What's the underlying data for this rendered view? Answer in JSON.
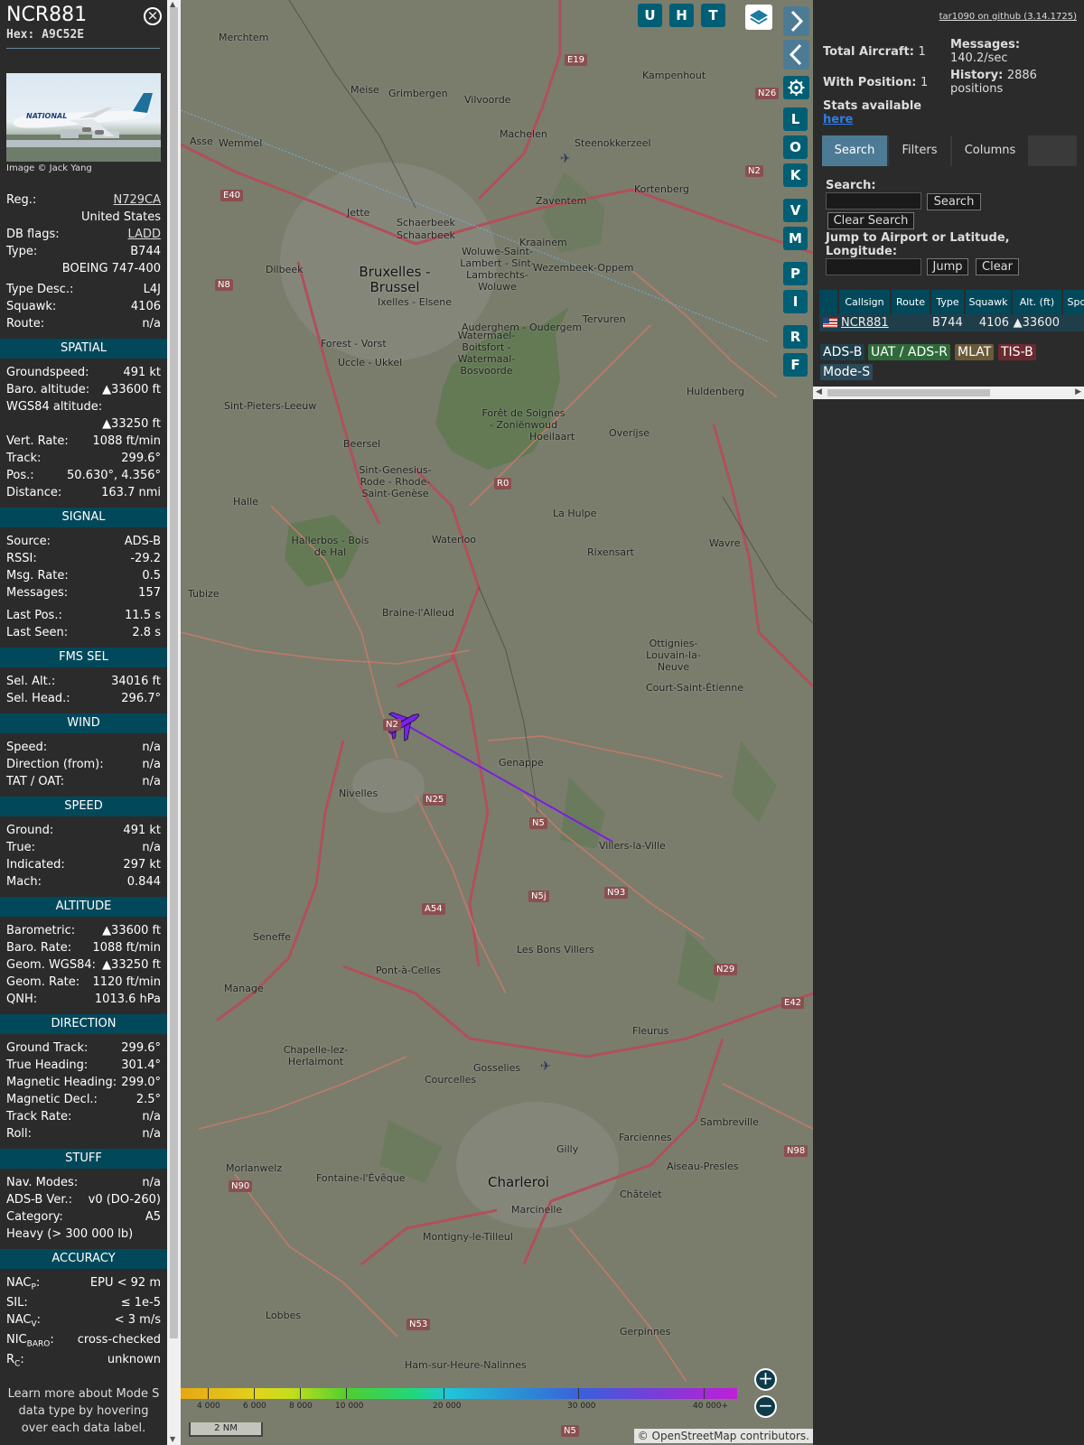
{
  "sidebar": {
    "callsign": "NCR881",
    "hex_label": "Hex: A9C52E",
    "photo_credit": "Image © Jack Yang",
    "photo_livery_text": "NATIONAL",
    "reg": {
      "label": "Reg.:",
      "value": "N729CA"
    },
    "country": "United States",
    "db_flags": {
      "label": "DB flags:",
      "value": "LADD"
    },
    "type": {
      "label": "Type:",
      "value": "B744"
    },
    "type_name": "BOEING 747-400",
    "type_desc": {
      "label": "Type Desc.:",
      "value": "L4J"
    },
    "squawk": {
      "label": "Squawk:",
      "value": "4106"
    },
    "route": {
      "label": "Route:",
      "value": "n/a"
    },
    "sections": {
      "spatial": "SPATIAL",
      "signal": "SIGNAL",
      "fms": "FMS SEL",
      "wind": "WIND",
      "speed": "SPEED",
      "altitude": "ALTITUDE",
      "direction": "DIRECTION",
      "stuff": "STUFF",
      "accuracy": "ACCURACY"
    },
    "spatial": {
      "groundspeed": {
        "label": "Groundspeed:",
        "value": "491 kt"
      },
      "baro_alt": {
        "label": "Baro. altitude:",
        "value": "▲33600 ft"
      },
      "wgs84_label": "WGS84 altitude:",
      "wgs84_value": "▲33250 ft",
      "vert_rate": {
        "label": "Vert. Rate:",
        "value": "1088 ft/min"
      },
      "track": {
        "label": "Track:",
        "value": "299.6°"
      },
      "pos": {
        "label": "Pos.:",
        "value": "50.630°, 4.356°"
      },
      "distance": {
        "label": "Distance:",
        "value": "163.7 nmi"
      }
    },
    "signal": {
      "source": {
        "label": "Source:",
        "value": "ADS-B"
      },
      "rssi": {
        "label": "RSSI:",
        "value": "-29.2"
      },
      "msg_rate": {
        "label": "Msg. Rate:",
        "value": "0.5"
      },
      "messages": {
        "label": "Messages:",
        "value": "157"
      },
      "last_pos": {
        "label": "Last Pos.:",
        "value": "11.5 s"
      },
      "last_seen": {
        "label": "Last Seen:",
        "value": "2.8 s"
      }
    },
    "fms": {
      "sel_alt": {
        "label": "Sel. Alt.:",
        "value": "34016 ft"
      },
      "sel_head": {
        "label": "Sel. Head.:",
        "value": "296.7°"
      }
    },
    "wind": {
      "speed": {
        "label": "Speed:",
        "value": "n/a"
      },
      "direction": {
        "label": "Direction (from):",
        "value": "n/a"
      },
      "tat_oat": {
        "label": "TAT / OAT:",
        "value": "n/a"
      }
    },
    "speed": {
      "ground": {
        "label": "Ground:",
        "value": "491 kt"
      },
      "true": {
        "label": "True:",
        "value": "n/a"
      },
      "indicated": {
        "label": "Indicated:",
        "value": "297 kt"
      },
      "mach": {
        "label": "Mach:",
        "value": "0.844"
      }
    },
    "altitude": {
      "barometric": {
        "label": "Barometric:",
        "value": "▲33600 ft"
      },
      "baro_rate": {
        "label": "Baro. Rate:",
        "value": "1088 ft/min"
      },
      "geom_wgs84": {
        "label": "Geom. WGS84:",
        "value": "▲33250 ft"
      },
      "geom_rate": {
        "label": "Geom. Rate:",
        "value": "1120 ft/min"
      },
      "qnh": {
        "label": "QNH:",
        "value": "1013.6 hPa"
      }
    },
    "direction": {
      "ground_track": {
        "label": "Ground Track:",
        "value": "299.6°"
      },
      "true_heading": {
        "label": "True Heading:",
        "value": "301.4°"
      },
      "mag_heading": {
        "label": "Magnetic Heading:",
        "value": "299.0°"
      },
      "mag_decl": {
        "label": "Magnetic Decl.:",
        "value": "2.5°"
      },
      "track_rate": {
        "label": "Track Rate:",
        "value": "n/a"
      },
      "roll": {
        "label": "Roll:",
        "value": "n/a"
      }
    },
    "stuff": {
      "nav_modes": {
        "label": "Nav. Modes:",
        "value": "n/a"
      },
      "adsb_ver": {
        "label": "ADS-B Ver.:",
        "value": "v0 (DO-260)"
      },
      "category": {
        "label": "Category:",
        "value": "A5"
      },
      "category_desc": "Heavy (> 300 000 lb)"
    },
    "accuracy": {
      "nacp": {
        "label_main": "NAC",
        "label_sub": "P",
        "value": "EPU < 92 m"
      },
      "sil": {
        "label": "SIL:",
        "value": "≤ 1e-5"
      },
      "nacv": {
        "label_main": "NAC",
        "label_sub": "V",
        "value": "< 3 m/s"
      },
      "nicbaro": {
        "label_main": "NIC",
        "label_sub": "BARO",
        "value": "cross-checked"
      },
      "rc": {
        "label_main": "R",
        "label_sub": "C",
        "value": "unknown"
      }
    },
    "footer_note": "Learn more about Mode S data type by hovering over each data label."
  },
  "map": {
    "buttons": {
      "u": "U",
      "h": "H",
      "t": "T",
      "l": "L",
      "o": "O",
      "k": "K",
      "v": "V",
      "m": "M",
      "p": "P",
      "i": "I",
      "r": "R",
      "f": "F"
    },
    "zoom_in": "+",
    "zoom_out": "−",
    "scale_label": "2 NM",
    "attribution": "© OpenStreetMap contributors.",
    "altitude_legend": [
      "4 000",
      "6 000",
      "8 000",
      "10 000",
      "20 000",
      "30 000",
      "40 000+"
    ],
    "places": [
      {
        "t": "Merchtem"
      },
      {
        "t": "Meise"
      },
      {
        "t": "Grimbergen"
      },
      {
        "t": "Vilvoorde"
      },
      {
        "t": "Machelen"
      },
      {
        "t": "Steenokkerzeel"
      },
      {
        "t": "Kampenhout"
      },
      {
        "t": "Asse"
      },
      {
        "t": "Wemmel"
      },
      {
        "t": "Zaventem"
      },
      {
        "t": "Kortenberg"
      },
      {
        "t": "Jette"
      },
      {
        "t": "Schaerbeek"
      },
      {
        "t": "Schaarbeek"
      },
      {
        "t": "Kraainem"
      },
      {
        "t": "Dilbeek"
      },
      {
        "t": "Woluwe-Saint-Lambert - Sint-Lambrechts-Woluwe"
      },
      {
        "t": "Wezembeek-Oppem"
      },
      {
        "t": "Ixelles - Elsene"
      },
      {
        "t": "Auderghem - Oudergem"
      },
      {
        "t": "Tervuren"
      },
      {
        "t": "Forest - Vorst"
      },
      {
        "t": "Uccle - Ukkel"
      },
      {
        "t": "Watermael-Boitsfort - Watermaal-Bosvoorde"
      },
      {
        "t": "Sint-Pieters-Leeuw"
      },
      {
        "t": "Huldenberg"
      },
      {
        "t": "Forêt de Soignes - Zoniënwoud"
      },
      {
        "t": "Hoeilaart"
      },
      {
        "t": "Overijse"
      },
      {
        "t": "Beersel"
      },
      {
        "t": "Sint-Genesius-Rode - Rhode-Saint-Genèse"
      },
      {
        "t": "Halle"
      },
      {
        "t": "La Hulpe"
      },
      {
        "t": "Waterloo"
      },
      {
        "t": "Rixensart"
      },
      {
        "t": "Wavre"
      },
      {
        "t": "Hallerbos - Bois de Hal"
      },
      {
        "t": "Tubize"
      },
      {
        "t": "Braine-l'Alleud"
      },
      {
        "t": "Ottignies-Louvain-la-Neuve"
      },
      {
        "t": "Court-Saint-Étienne"
      },
      {
        "t": "Genappe"
      },
      {
        "t": "Nivelles"
      },
      {
        "t": "Villers-la-Ville"
      },
      {
        "t": "Seneffe"
      },
      {
        "t": "Les Bons Villers"
      },
      {
        "t": "Manage"
      },
      {
        "t": "Pont-à-Celles"
      },
      {
        "t": "Fleurus"
      },
      {
        "t": "Chapelle-lez-Herlaimont"
      },
      {
        "t": "Courcelles"
      },
      {
        "t": "Gosselies"
      },
      {
        "t": "Sambreville"
      },
      {
        "t": "Morlanwelz"
      },
      {
        "t": "Farciennes"
      },
      {
        "t": "Aiseau-Presles"
      },
      {
        "t": "Gilly"
      },
      {
        "t": "Fontaine-l'Évêque"
      },
      {
        "t": "Charleroi"
      },
      {
        "t": "Châtelet"
      },
      {
        "t": "Marcinelle"
      },
      {
        "t": "Montigny-le-Tilleul"
      },
      {
        "t": "Lobbes"
      },
      {
        "t": "Gerpinnes"
      },
      {
        "t": "Ham-sur-Heure-Nalinnes"
      },
      {
        "t": "Bruxelles - Brussel"
      }
    ],
    "roads": [
      "E19",
      "N26",
      "N2",
      "E40",
      "N8",
      "R0",
      "N25",
      "N5",
      "N5j",
      "N93",
      "A54",
      "N29",
      "E42",
      "N98",
      "N90",
      "N53",
      "N5",
      "N2"
    ]
  },
  "rpanel": {
    "github_link": "tar1090 on github (3.14.1725)",
    "total_aircraft_label": "Total Aircraft:",
    "total_aircraft": "1",
    "with_position_label": "With Position:",
    "with_position": "1",
    "messages_label": "Messages:",
    "messages_value": "140.2/sec",
    "history_label": "History:",
    "history_value": "2886",
    "history_unit": "positions",
    "stats_label": "Stats available",
    "stats_link": "here",
    "tabs": [
      "Search",
      "Filters",
      "Columns"
    ],
    "search_label": "Search:",
    "search_button": "Search",
    "clear_search_button": "Clear Search",
    "jump_label": "Jump to Airport or Latitude, Longitude:",
    "jump_button": "Jump",
    "clear_button": "Clear",
    "table": {
      "headers": [
        "",
        "Callsign",
        "Route",
        "Type",
        "Squawk",
        "Alt. (ft)",
        "Spd"
      ],
      "row": {
        "callsign": "NCR881",
        "route": "",
        "type": "B744",
        "squawk": "4106",
        "alt": "▲33600"
      }
    },
    "legend": [
      "ADS-B",
      "UAT / ADS-R",
      "MLAT",
      "TIS-B",
      "Mode-S"
    ],
    "colors": {
      "section": "#02485b",
      "accent": "#4d7b95",
      "track": "#7a1fe0",
      "adsb": "#1f3e4a",
      "uat": "#2f6b3a",
      "mlat": "#6b5a3a",
      "tisb": "#6a2a30",
      "modes": "#2a4a5a"
    }
  }
}
